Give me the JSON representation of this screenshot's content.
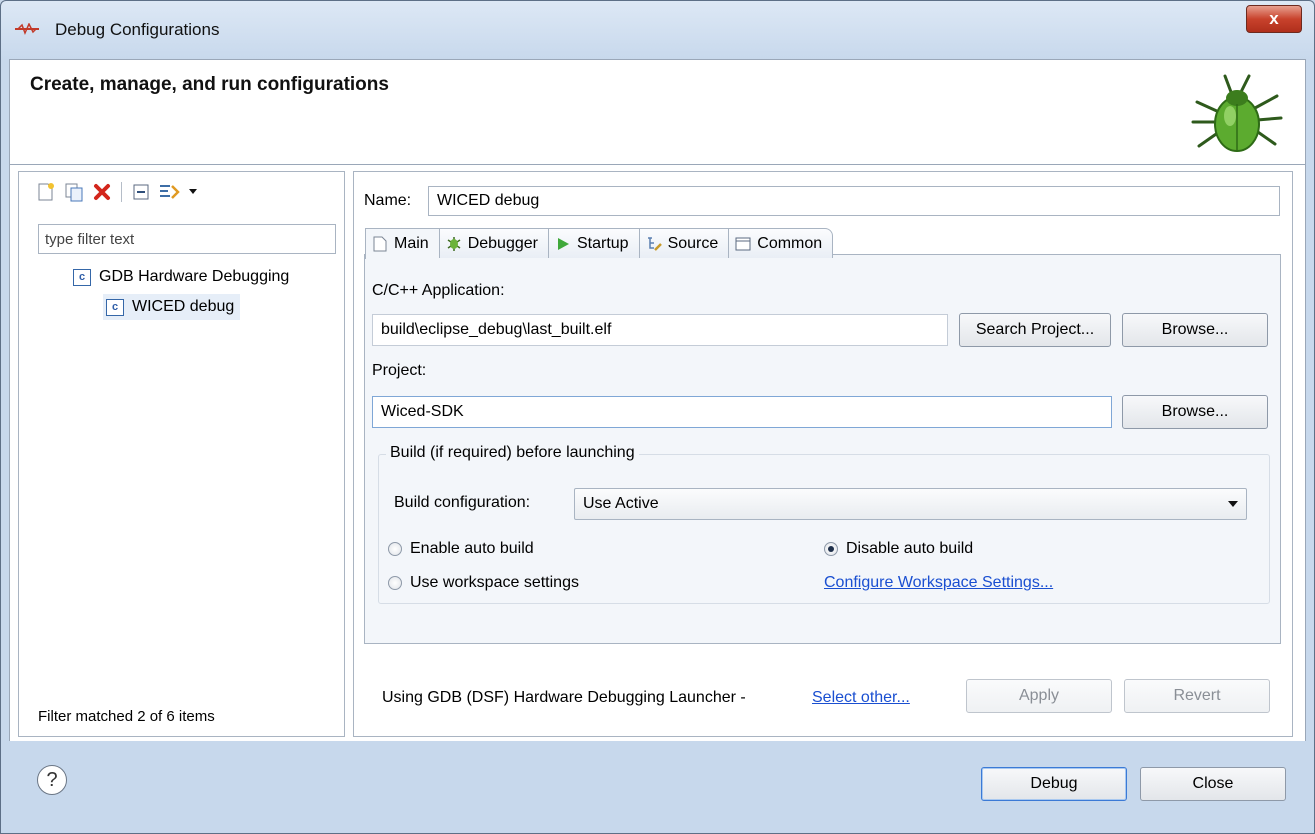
{
  "window": {
    "title": "Debug Configurations",
    "close_label": "x"
  },
  "header": {
    "title": "Create, manage, and run configurations"
  },
  "left": {
    "filter_placeholder": "type filter text",
    "tree": [
      {
        "label": "GDB Hardware Debugging",
        "icon": "c-file-icon"
      },
      {
        "label": "WICED debug",
        "icon": "c-file-icon",
        "selected": true
      }
    ],
    "filter_status": "Filter matched 2 of 6 items"
  },
  "config": {
    "name_label": "Name:",
    "name_value": "WICED debug",
    "tabs": [
      {
        "label": "Main",
        "icon": "main-tab-icon",
        "active": true
      },
      {
        "label": "Debugger",
        "icon": "debugger-tab-icon"
      },
      {
        "label": "Startup",
        "icon": "startup-tab-icon"
      },
      {
        "label": "Source",
        "icon": "source-tab-icon"
      },
      {
        "label": "Common",
        "icon": "common-tab-icon"
      }
    ],
    "app_label": "C/C++ Application:",
    "app_value": "build\\eclipse_debug\\last_built.elf",
    "search_project_label": "Search Project...",
    "browse_label": "Browse...",
    "project_label": "Project:",
    "project_value": "Wiced-SDK",
    "build_group_title": "Build (if required) before launching",
    "build_config_label": "Build configuration:",
    "build_config_value": "Use Active",
    "radios": {
      "enable_auto": "Enable auto build",
      "disable_auto": "Disable auto build",
      "workspace": "Use workspace settings"
    },
    "configure_link": "Configure Workspace Settings...",
    "launcher_text": "Using GDB (DSF) Hardware Debugging Launcher -",
    "select_other_link": "Select other...",
    "apply_label": "Apply",
    "revert_label": "Revert"
  },
  "footer": {
    "help": "?",
    "debug_label": "Debug",
    "close_label": "Close"
  },
  "colors": {
    "accent": "#3b7ad6",
    "link": "#1a4fd1",
    "close_red": "#c8422c"
  }
}
